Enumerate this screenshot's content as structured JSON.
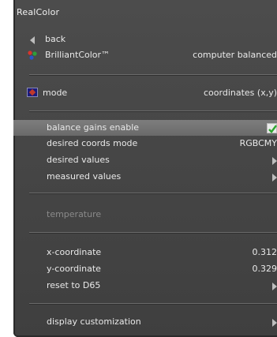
{
  "window": {
    "title": "RealColor"
  },
  "menu": {
    "back_label": "back",
    "brilliantcolor": {
      "label": "BrilliantColor™",
      "value": "computer balanced"
    },
    "mode": {
      "label": "mode",
      "value": "coordinates (x,y)"
    },
    "balance_gains": {
      "label": "balance gains enable",
      "checked": true
    },
    "desired_coords_mode": {
      "label": "desired coords mode",
      "value": "RGBCMY"
    },
    "desired_values": {
      "label": "desired values"
    },
    "measured_values": {
      "label": "measured values"
    },
    "temperature": {
      "label": "temperature"
    },
    "x_coordinate": {
      "label": "x-coordinate",
      "value": "0.312"
    },
    "y_coordinate": {
      "label": "y-coordinate",
      "value": "0.329"
    },
    "reset": {
      "label": "reset to D65"
    },
    "display_customization": {
      "label": "display customization"
    }
  },
  "icons": {
    "back": "left-arrow-icon",
    "brilliantcolor": "color-dots-icon",
    "mode": "mode-icon",
    "submenu": "right-arrow-icon",
    "checkbox": "checkmark-icon"
  },
  "colors": {
    "panel": "#474747",
    "highlight": "#747474",
    "text": "#e9e9e9",
    "disabled_text": "#8a8a8a",
    "check": "#2fa52f"
  }
}
